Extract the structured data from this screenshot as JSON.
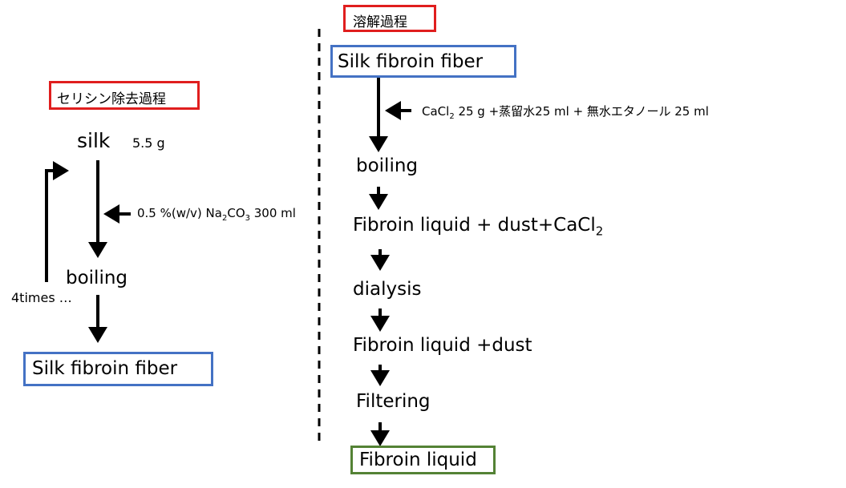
{
  "left": {
    "header": "セリシン除去過程",
    "silk": "silk",
    "silk_mass": "5.5 g",
    "reagent_prefix": "0.5 %(w/v) Na",
    "reagent_sub1": "2",
    "reagent_mid": "CO",
    "reagent_sub2": "3",
    "reagent_suffix": " 300 ml",
    "boiling": "boiling",
    "repeat": "4times …",
    "result": "Silk fibroin fiber"
  },
  "right": {
    "header": "溶解過程",
    "start": "Silk fibroin fiber",
    "reagent_prefix": "CaCl",
    "reagent_sub": "2",
    "reagent_suffix": " 25 g +蒸留水25 ml + 無水エタノール 25 ml",
    "step1": "boiling",
    "step2_prefix": "Fibroin liquid + dust+CaCl",
    "step2_sub": "2",
    "step3": "dialysis",
    "step4": "Fibroin liquid +dust",
    "step5": "Filtering",
    "result": "Fibroin liquid"
  },
  "colors": {
    "header_border": "#e01e1e",
    "fiber_border": "#4472c4",
    "liquid_border": "#548235"
  }
}
